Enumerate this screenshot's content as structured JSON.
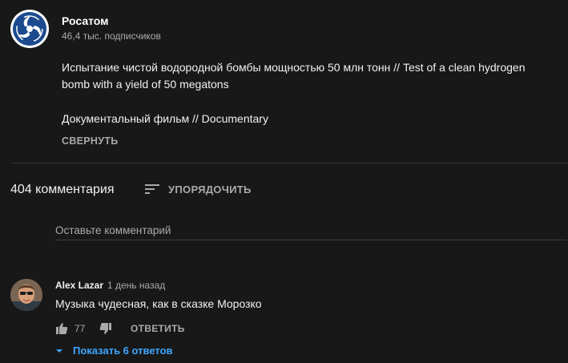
{
  "channel": {
    "name": "Росатом",
    "subscribers": "46,4 тыс. подписчиков",
    "logo_icon": "rosatom-logo"
  },
  "description": {
    "lines": [
      "Испытание чистой водородной бомбы мощностью 50 млн тонн // Test of a clean hydrogen",
      "bomb with a yield of 50 megatons",
      "Документальный фильм // Documentary"
    ],
    "collapse_label": "СВЕРНУТЬ"
  },
  "comments_header": {
    "count_label": "404 комментария",
    "sort_label": "УПОРЯДОЧИТЬ",
    "sort_icon": "sort-icon"
  },
  "comment_input": {
    "placeholder": "Оставьте комментарий"
  },
  "comments": [
    {
      "author": "Alex Lazar",
      "time": "1 день назад",
      "text": "Музыка чудесная, как в сказке Морозко",
      "likes": "77",
      "reply_label": "ОТВЕТИТЬ",
      "show_replies_label": "Показать 6 ответов"
    }
  ],
  "colors": {
    "background": "#181818",
    "text_primary": "#f1f1f1",
    "text_secondary": "#aaaaaa",
    "link_blue": "#3ea6ff",
    "logo_blue": "#1b4a8f"
  }
}
